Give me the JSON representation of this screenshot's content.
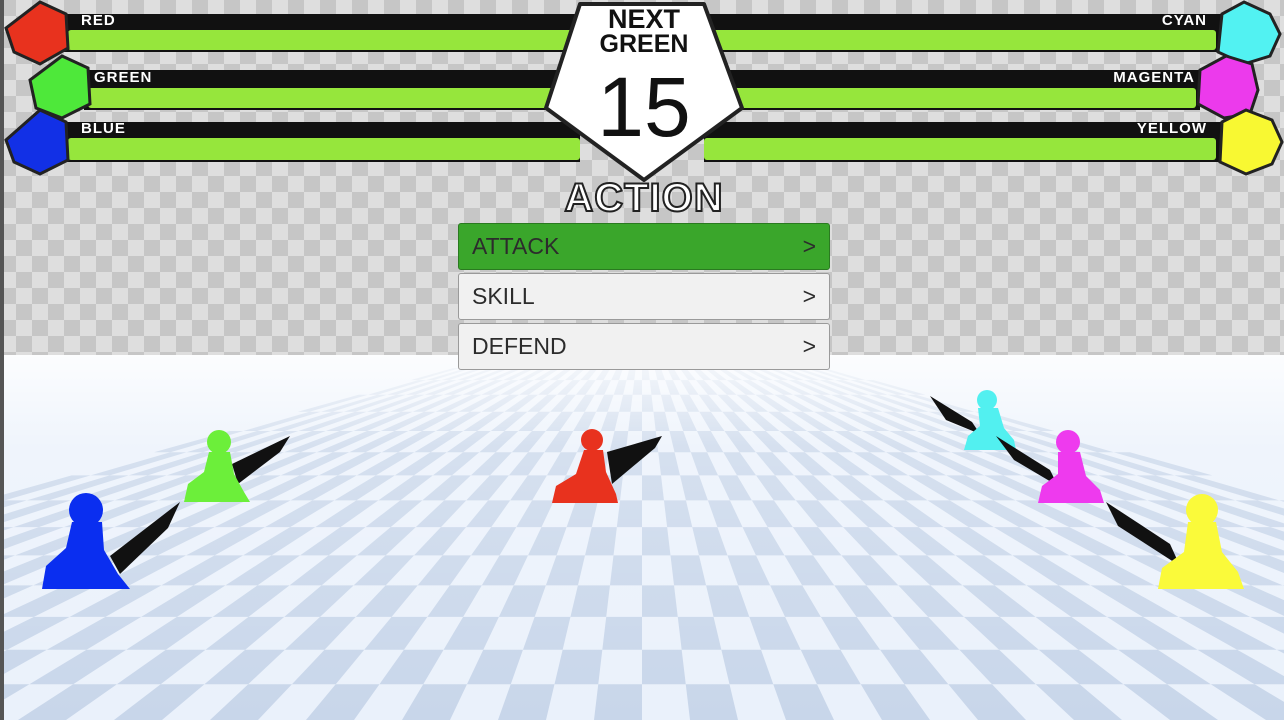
{
  "hud": {
    "left_bars": [
      {
        "name": "RED",
        "color": "#e8321e",
        "hp_fraction": 1.0
      },
      {
        "name": "GREEN",
        "color": "#4ee83a",
        "hp_fraction": 1.0
      },
      {
        "name": "BLUE",
        "color": "#1230e6",
        "hp_fraction": 1.0
      }
    ],
    "right_bars": [
      {
        "name": "CYAN",
        "color": "#52f2f2",
        "hp_fraction": 1.0
      },
      {
        "name": "MAGENTA",
        "color": "#ec3aec",
        "hp_fraction": 1.0
      },
      {
        "name": "YELLOW",
        "color": "#f8f832",
        "hp_fraction": 1.0
      }
    ],
    "hp_color": "#96e63c",
    "next": {
      "title": "NEXT",
      "name": "GREEN",
      "count": "15"
    }
  },
  "action_menu": {
    "title": "ACTION",
    "items": [
      {
        "label": "ATTACK",
        "arrow": ">",
        "selected": true
      },
      {
        "label": "SKILL",
        "arrow": ">",
        "selected": false
      },
      {
        "label": "DEFEND",
        "arrow": ">",
        "selected": false
      }
    ],
    "selected_color": "#3aa62b"
  },
  "units": [
    {
      "name": "red",
      "color": "#e8321e"
    },
    {
      "name": "green",
      "color": "#6cef3a"
    },
    {
      "name": "blue",
      "color": "#0a2ef0"
    },
    {
      "name": "cyan",
      "color": "#52f0f0"
    },
    {
      "name": "magenta",
      "color": "#ee3aee"
    },
    {
      "name": "yellow",
      "color": "#fafa3a"
    }
  ]
}
